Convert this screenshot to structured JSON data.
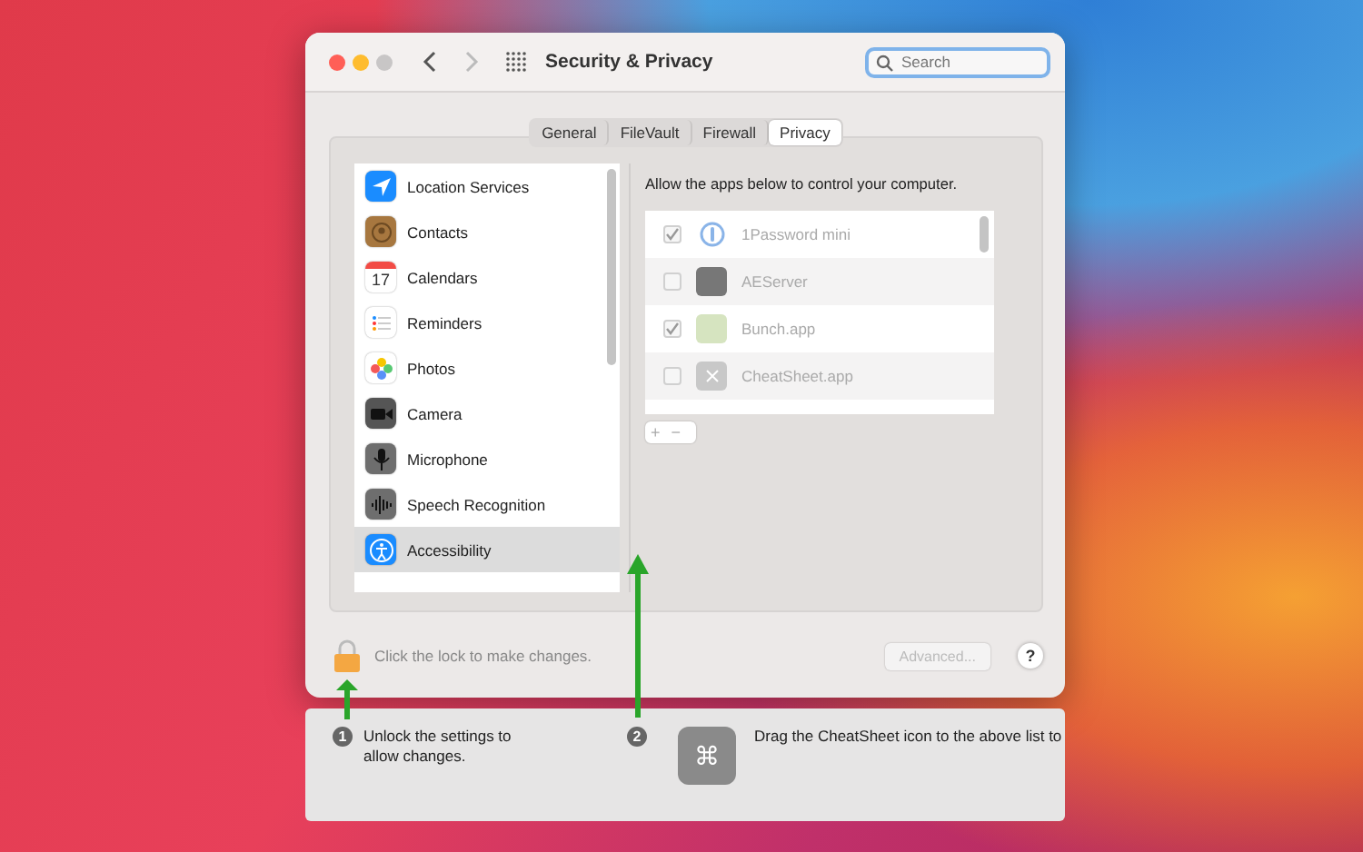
{
  "window": {
    "title": "Security & Privacy",
    "search": {
      "placeholder": "Search"
    }
  },
  "tabs": [
    {
      "label": "General",
      "selected": false
    },
    {
      "label": "FileVault",
      "selected": false
    },
    {
      "label": "Firewall",
      "selected": false
    },
    {
      "label": "Privacy",
      "selected": true
    }
  ],
  "privacy_list": [
    {
      "label": "Location Services",
      "selected": false
    },
    {
      "label": "Contacts",
      "selected": false
    },
    {
      "label": "Calendars",
      "selected": false
    },
    {
      "label": "Reminders",
      "selected": false
    },
    {
      "label": "Photos",
      "selected": false
    },
    {
      "label": "Camera",
      "selected": false
    },
    {
      "label": "Microphone",
      "selected": false
    },
    {
      "label": "Speech Recognition",
      "selected": false
    },
    {
      "label": "Accessibility",
      "selected": true
    }
  ],
  "calendar_day": "17",
  "panel": {
    "description": "Allow the apps below to control your computer.",
    "apps": [
      {
        "name": "1Password mini",
        "checked": true
      },
      {
        "name": "AEServer",
        "checked": false
      },
      {
        "name": "Bunch.app",
        "checked": true
      },
      {
        "name": "CheatSheet.app",
        "checked": false
      }
    ],
    "add": "+",
    "remove": "−"
  },
  "lock_text": "Click the lock to make changes.",
  "advanced_button": {
    "label": "Advanced...",
    "disabled": true
  },
  "help": "?",
  "guide": {
    "steps": [
      {
        "number": "1",
        "text": "Unlock the settings to allow changes."
      },
      {
        "number": "2",
        "text": "Drag the CheatSheet icon to the above list to"
      }
    ],
    "key_symbol": "⌘"
  }
}
